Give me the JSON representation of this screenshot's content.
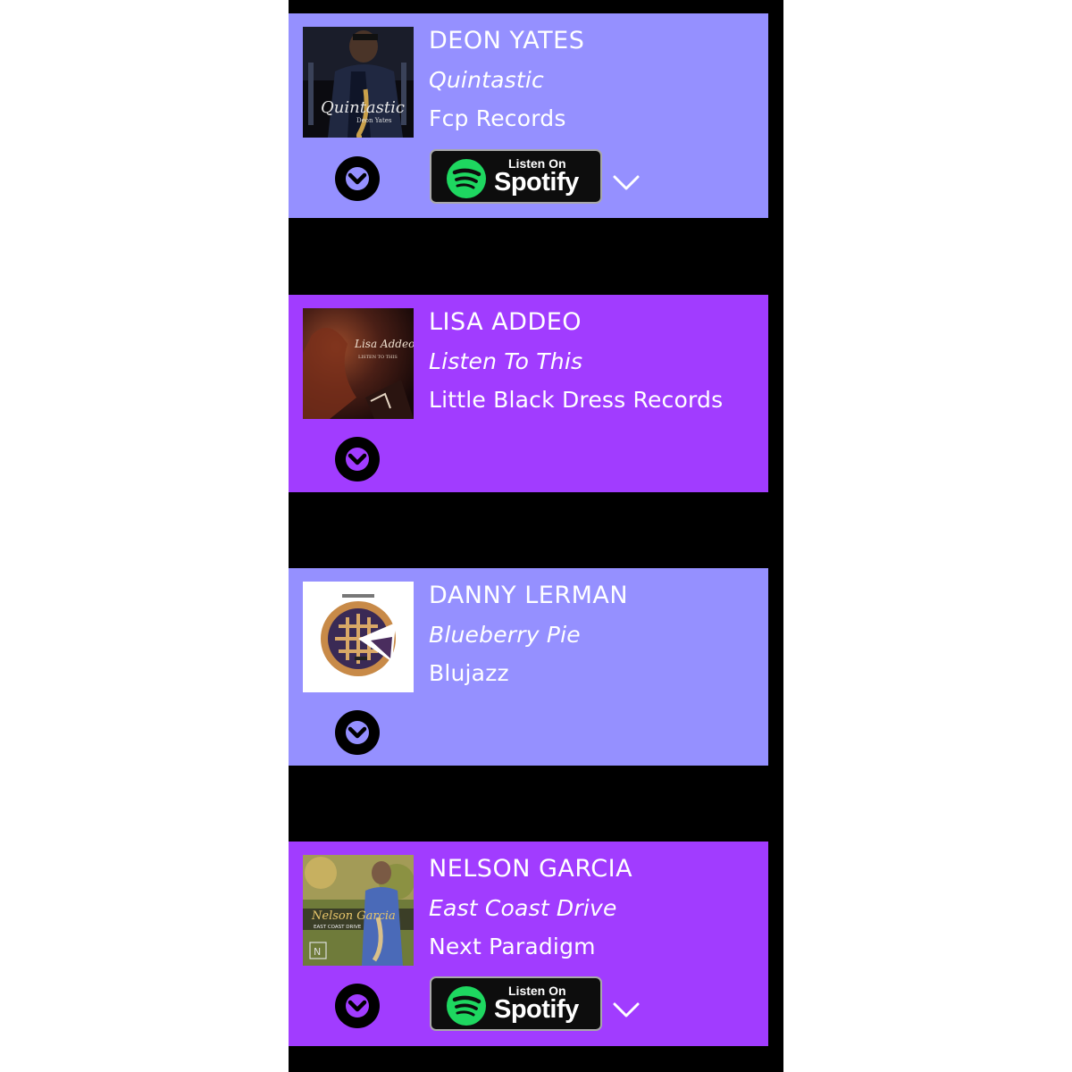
{
  "colors": {
    "card_light": "#9590ff",
    "card_dark": "#a13cff",
    "spotify_green": "#1ed760",
    "background": "#000000"
  },
  "cards": [
    {
      "artist": "DEON YATES",
      "album": "Quintastic",
      "label": "Fcp Records",
      "art_caption": "Quintastic",
      "art_subcaption": "Deon Yates",
      "has_spotify": true
    },
    {
      "artist": "LISA ADDEO",
      "album": "Listen To This",
      "label": "Little Black Dress Records",
      "art_caption": "Lisa Addeo",
      "art_subcaption": "LISTEN TO THIS",
      "has_spotify": false
    },
    {
      "artist": "DANNY LERMAN",
      "album": "Blueberry Pie",
      "label": "Blujazz",
      "art_caption": "",
      "art_subcaption": "",
      "has_spotify": false
    },
    {
      "artist": "NELSON GARCIA",
      "album": "East Coast Drive",
      "label": "Next Paradigm",
      "art_caption": "Nelson Garcia",
      "art_subcaption": "EAST COAST DRIVE",
      "has_spotify": true
    }
  ],
  "spotify_badge": {
    "listen_text": "Listen On",
    "brand_text": "Spotify"
  },
  "icons": {
    "expand": "chevron-down-circle-icon",
    "more": "chevron-down-icon",
    "spotify": "spotify-logo-icon"
  }
}
